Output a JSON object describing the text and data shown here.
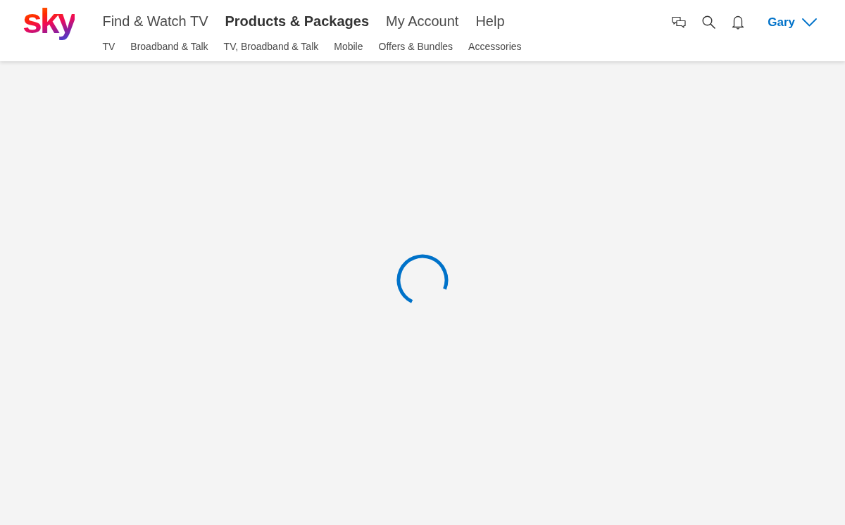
{
  "logo": {
    "text": "sky"
  },
  "main_nav": [
    {
      "label": "Find & Watch TV",
      "selected": false
    },
    {
      "label": "Products & Packages",
      "selected": true
    },
    {
      "label": "My Account",
      "selected": false
    },
    {
      "label": "Help",
      "selected": false
    }
  ],
  "sub_nav": [
    {
      "label": "TV",
      "selected": false
    },
    {
      "label": "Broadband & Talk",
      "selected": false
    },
    {
      "label": "TV, Broadband & Talk",
      "selected": false
    },
    {
      "label": "Mobile",
      "selected": false
    },
    {
      "label": "Offers & Bundles",
      "selected": false
    },
    {
      "label": "Accessories",
      "selected": false
    }
  ],
  "user": {
    "name": "Gary"
  },
  "content": {
    "loading": true
  }
}
